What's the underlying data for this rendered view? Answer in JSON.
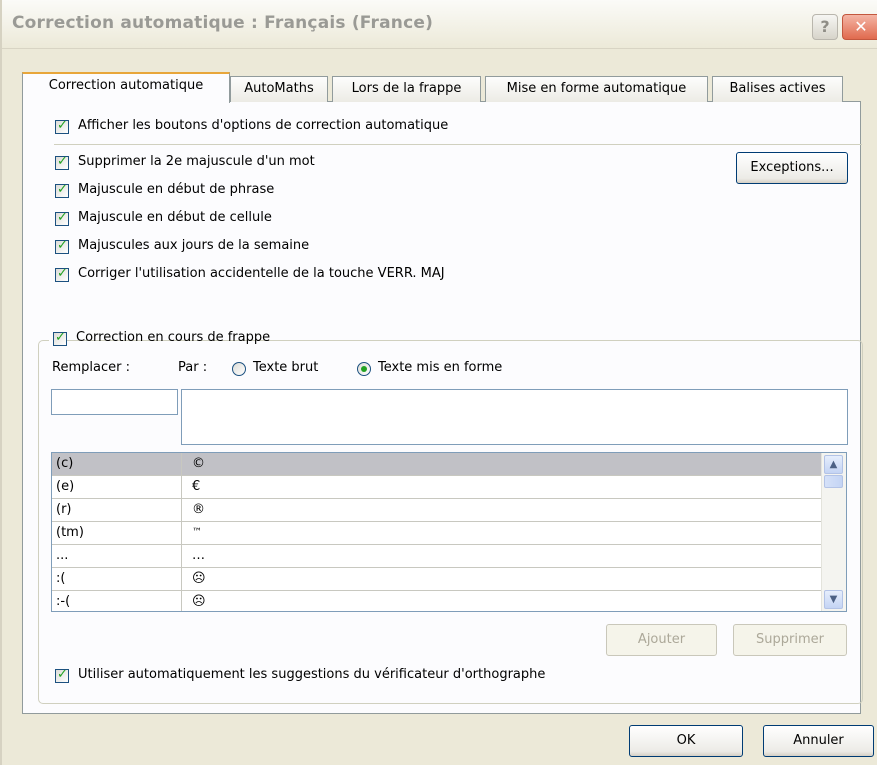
{
  "window": {
    "title": "Correction automatique : Français (France)",
    "help_glyph": "?",
    "close_glyph": "✕"
  },
  "tabs": [
    {
      "label": "Correction automatique",
      "active": true
    },
    {
      "label": "AutoMaths"
    },
    {
      "label": "Lors de la frappe"
    },
    {
      "label": "Mise en forme automatique"
    },
    {
      "label": "Balises actives"
    }
  ],
  "options": {
    "show_buttons": "Afficher les boutons d'options de correction automatique",
    "two_caps": "Supprimer la 2e majuscule d'un mot",
    "sentence_caps": "Majuscule en début de phrase",
    "cell_caps": "Majuscule en début de cellule",
    "day_caps": "Majuscules aux jours de la semaine",
    "caps_lock": "Corriger l'utilisation accidentelle de la touche VERR. MAJ",
    "exceptions_button": "Exceptions..."
  },
  "replace_group": {
    "legend": "Correction en cours de frappe",
    "replace_label": "Remplacer :",
    "with_label": "Par :",
    "radio_plain": "Texte brut",
    "radio_formatted": "Texte mis en forme",
    "selected_radio": "formatted",
    "replace_value": "",
    "with_value": ""
  },
  "entries": [
    {
      "from": "(c)",
      "to": "©"
    },
    {
      "from": "(e)",
      "to": "€"
    },
    {
      "from": "(r)",
      "to": "®"
    },
    {
      "from": "(tm)",
      "to": "™"
    },
    {
      "from": "...",
      "to": "…"
    },
    {
      "from": ":(",
      "to": "☹"
    },
    {
      "from": ":-(",
      "to": "☹"
    }
  ],
  "list_buttons": {
    "add": "Ajouter",
    "delete": "Supprimer"
  },
  "spell_option": "Utiliser automatiquement les suggestions du vérificateur d'orthographe",
  "footer": {
    "ok": "OK",
    "cancel": "Annuler"
  },
  "scroll_up_glyph": "▲",
  "scroll_down_glyph": "▼"
}
